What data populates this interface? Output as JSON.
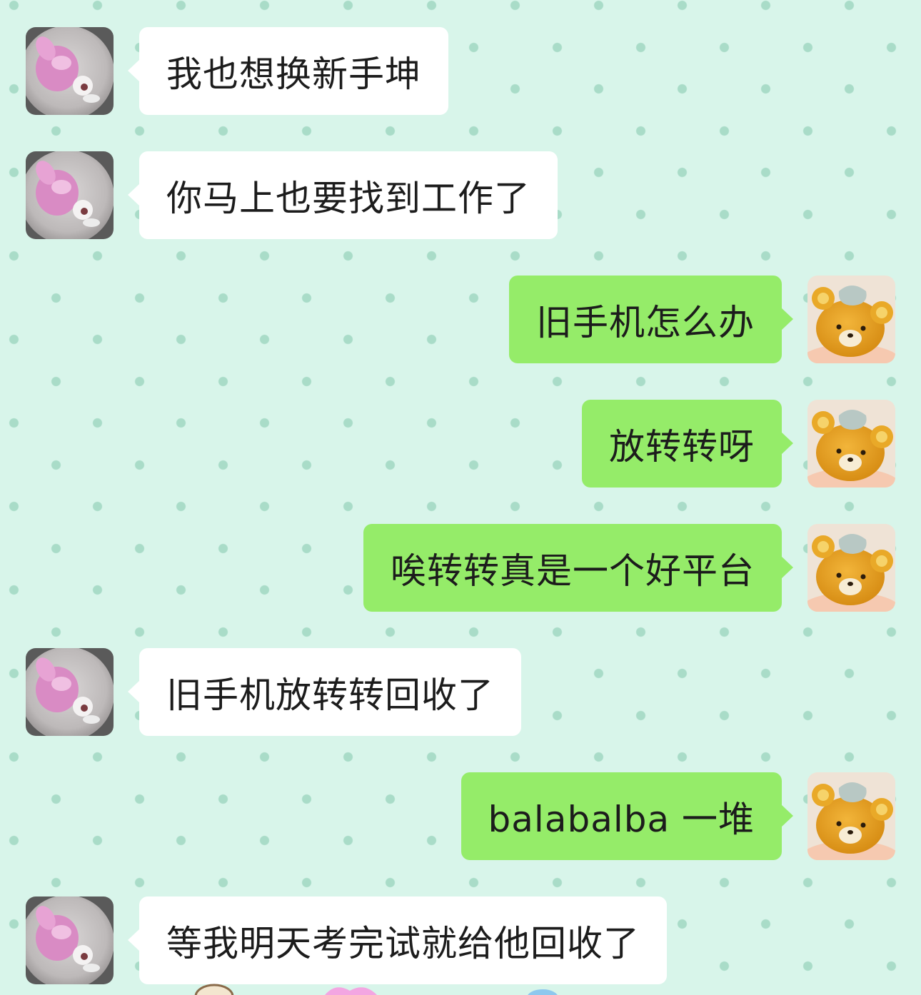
{
  "chat": {
    "messages": [
      {
        "side": "left",
        "avatar": "pink-plush-avatar",
        "text": "我也想换新手坤"
      },
      {
        "side": "left",
        "avatar": "pink-plush-avatar",
        "text": "你马上也要找到工作了"
      },
      {
        "side": "right",
        "avatar": "bear-plush-avatar",
        "text": "旧手机怎么办"
      },
      {
        "side": "right",
        "avatar": "bear-plush-avatar",
        "text": "放转转呀"
      },
      {
        "side": "right",
        "avatar": "bear-plush-avatar",
        "text": "唉转转真是一个好平台"
      },
      {
        "side": "left",
        "avatar": "pink-plush-avatar",
        "text": "旧手机放转转回收了"
      },
      {
        "side": "right",
        "avatar": "bear-plush-avatar",
        "text": "balabalba 一堆"
      },
      {
        "side": "left",
        "avatar": "pink-plush-avatar",
        "text": "等我明天考完试就给他回收了"
      }
    ]
  },
  "colors": {
    "background": "#d8f5ea",
    "incoming_bubble": "#ffffff",
    "outgoing_bubble": "#95ec69",
    "text": "#1c1c1c"
  }
}
